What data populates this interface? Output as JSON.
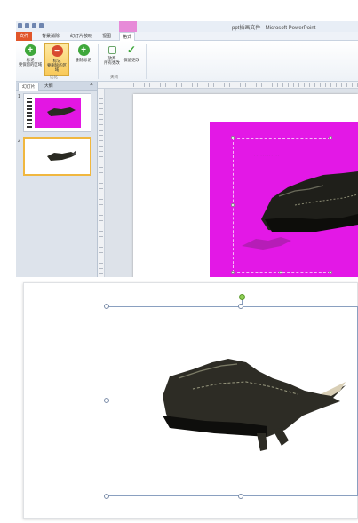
{
  "window": {
    "title": "ppt插画文件 - Microsoft PowerPoint"
  },
  "tabs": {
    "file": "文件",
    "background_removal": "背景消除",
    "slideshow": "幻灯片放映",
    "view": "视图",
    "format": "格式"
  },
  "ribbon": {
    "mark_keep_label": "标记\n要保留的区域",
    "mark_remove_label": "标记\n要删除的区域",
    "delete_mark_label": "删除标记",
    "discard_label": "放弃\n所有更改",
    "keep_changes_label": "保留更改",
    "group_optimize": "优化",
    "group_close": "关闭"
  },
  "panel": {
    "tab_slides": "幻灯片",
    "tab_outline": "大纲",
    "close": "×",
    "thumbs": [
      {
        "num": "1"
      },
      {
        "num": "2"
      }
    ]
  },
  "colors": {
    "magenta_background": "#e318e6",
    "file_tab": "#e1562a",
    "selected_thumb_border": "#f0b73f",
    "context_tab": "#e78ad8"
  }
}
